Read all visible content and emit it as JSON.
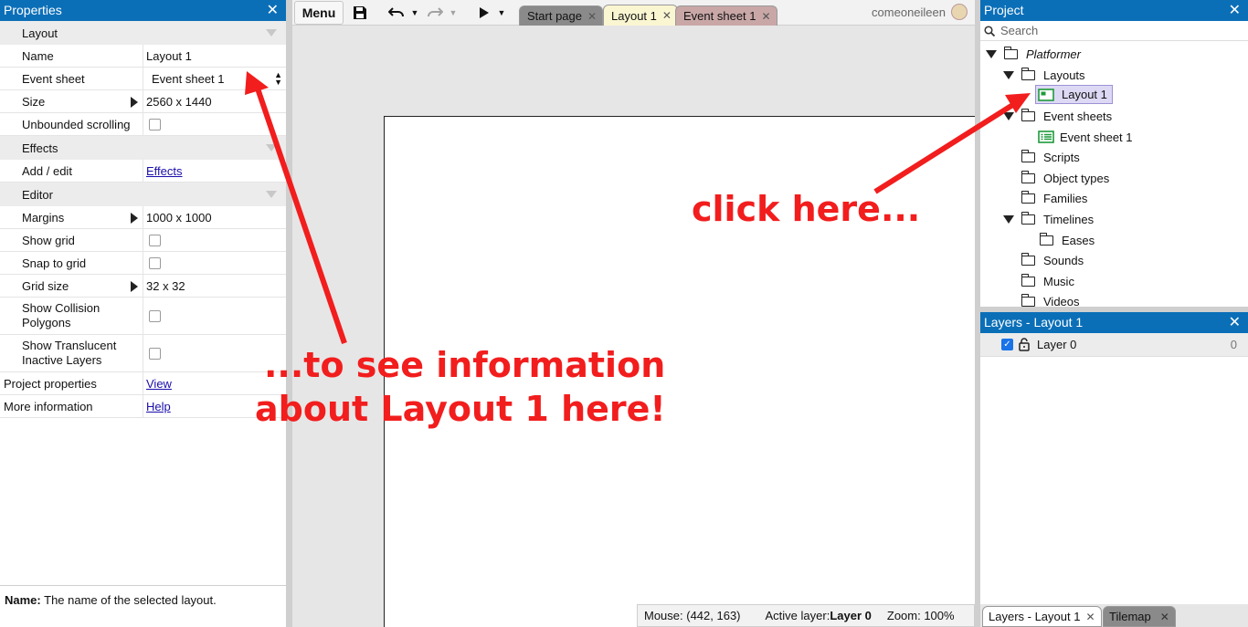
{
  "properties": {
    "title": "Properties",
    "close": "✕",
    "layout_section": "Layout",
    "rows": {
      "name_k": "Name",
      "name_v": "Layout 1",
      "event_k": "Event sheet",
      "event_v": "Event sheet 1",
      "size_k": "Size",
      "size_v": "2560 x 1440",
      "unb_k": "Unbounded scrolling"
    },
    "effects_section": "Effects",
    "effects_k": "Add / edit",
    "effects_v": "Effects",
    "editor_section": "Editor",
    "editor": {
      "margins_k": "Margins",
      "margins_v": "1000 x 1000",
      "grid_k": "Show grid",
      "snap_k": "Snap to grid",
      "gridsize_k": "Grid size",
      "gridsize_v": "32 x 32",
      "coll_k": "Show Collision Polygons",
      "trans_k": "Show Translucent Inactive Layers"
    },
    "proj_k": "Project properties",
    "proj_v": "View",
    "more_k": "More information",
    "more_v": "Help",
    "footer_bold": "Name:",
    "footer_text": " The name of the selected layout."
  },
  "toolbar": {
    "menu": "Menu",
    "tabs": [
      "Start page",
      "Layout 1",
      "Event sheet 1"
    ],
    "tab_close": "✕",
    "user": "comeoneileen"
  },
  "status": {
    "mouse": "Mouse: (442, 163)",
    "active_label": "Active layer: ",
    "active_value": "Layer 0",
    "zoom": "Zoom: 100%"
  },
  "project": {
    "title": "Project",
    "close": "✕",
    "search_placeholder": "Search",
    "tree": {
      "root": "Platformer",
      "layouts": "Layouts",
      "layout1": "Layout 1",
      "eventsheets": "Event sheets",
      "eventsheet1": "Event sheet 1",
      "scripts": "Scripts",
      "objecttypes": "Object types",
      "families": "Families",
      "timelines": "Timelines",
      "eases": "Eases",
      "sounds": "Sounds",
      "music": "Music",
      "videos": "Videos"
    }
  },
  "layers": {
    "title": "Layers - Layout 1",
    "close": "✕",
    "layer_name": "Layer 0",
    "layer_index": "0"
  },
  "bottom_tabs": [
    "Layers - Layout 1",
    "Tilemap"
  ],
  "annotations": {
    "click": "click here...",
    "info_line1": "...to see information",
    "info_line2": "about Layout 1 here!"
  },
  "colors": {
    "accent": "#0b6fb8",
    "annotation": "#f21d1d",
    "selected_node": "#ddd9f5"
  }
}
